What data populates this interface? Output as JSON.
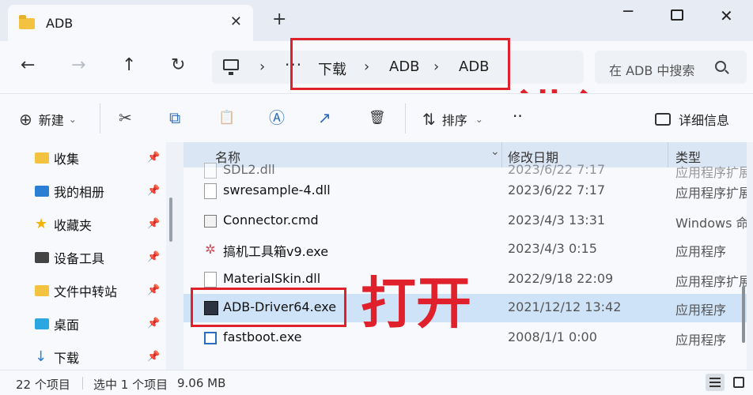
{
  "tab": {
    "title": "ADB",
    "close": "✕",
    "new": "+"
  },
  "window": {
    "minimize": "─",
    "close": "✕"
  },
  "nav": {
    "back": "←",
    "forward": "→",
    "up": "↑",
    "refresh": "↻"
  },
  "address": {
    "more": "···",
    "separators": [
      "›",
      "›",
      "›",
      "›"
    ],
    "crumbs": [
      "下载",
      "ADB",
      "ADB"
    ]
  },
  "search": {
    "placeholder": "在 ADB 中搜索"
  },
  "annotations": {
    "enter": "进入",
    "open": "打开"
  },
  "toolbar": {
    "new_label": "新建",
    "new_icon": "⊕",
    "dropdown": "⌄",
    "sort_label": "排序",
    "sort_icon": "⇅",
    "more": "··",
    "details_label": "详细信息",
    "cut_icon": "✂",
    "copy_icon": "⧉",
    "paste_icon": "📋",
    "rename_icon": "Ⓐ",
    "share_icon": "↗",
    "delete_icon": "🗑"
  },
  "sidebar": {
    "items": [
      {
        "label": "收集",
        "icon": "folder-icon",
        "color": "#f3c241"
      },
      {
        "label": "我的相册",
        "icon": "photos-icon",
        "color": "#2a7fd4"
      },
      {
        "label": "收藏夹",
        "icon": "star-icon",
        "color": "#f2b400"
      },
      {
        "label": "设备工具",
        "icon": "camera-icon",
        "color": "#444444"
      },
      {
        "label": "文件中转站",
        "icon": "folder-icon",
        "color": "#f3c241"
      },
      {
        "label": "桌面",
        "icon": "desktop-icon",
        "color": "#2aa6e0"
      },
      {
        "label": "下载",
        "icon": "download-icon",
        "color": "#2a7fd4"
      }
    ],
    "pin": "📌"
  },
  "filelist": {
    "columns": {
      "name": "名称",
      "modified": "修改日期",
      "type": "类型"
    },
    "sort_icon": "⌄",
    "rows": [
      {
        "name": "SDL2.dll",
        "date": "2023/6/22 7:17",
        "type": "应用程序扩展",
        "icon": "dll-icon"
      },
      {
        "name": "swresample-4.dll",
        "date": "2023/6/22 7:17",
        "type": "应用程序扩展",
        "icon": "dll-icon"
      },
      {
        "name": "Connector.cmd",
        "date": "2023/4/3 13:31",
        "type": "Windows 命令脚本",
        "icon": "cmd-icon"
      },
      {
        "name": "搞机工具箱v9.exe",
        "date": "2023/4/3 0:15",
        "type": "应用程序",
        "icon": "gear-exe-icon"
      },
      {
        "name": "MaterialSkin.dll",
        "date": "2022/9/18 22:09",
        "type": "应用程序扩展",
        "icon": "dll-icon"
      },
      {
        "name": "ADB-Driver64.exe",
        "date": "2021/12/12 13:42",
        "type": "应用程序",
        "icon": "adb-exe-icon",
        "selected": true
      },
      {
        "name": "fastboot.exe",
        "date": "2008/1/1 0:00",
        "type": "应用程序",
        "icon": "exe-icon"
      }
    ]
  },
  "status": {
    "count": "22 个项目",
    "selection": "选中 1 个项目",
    "size": "9.06 MB"
  }
}
